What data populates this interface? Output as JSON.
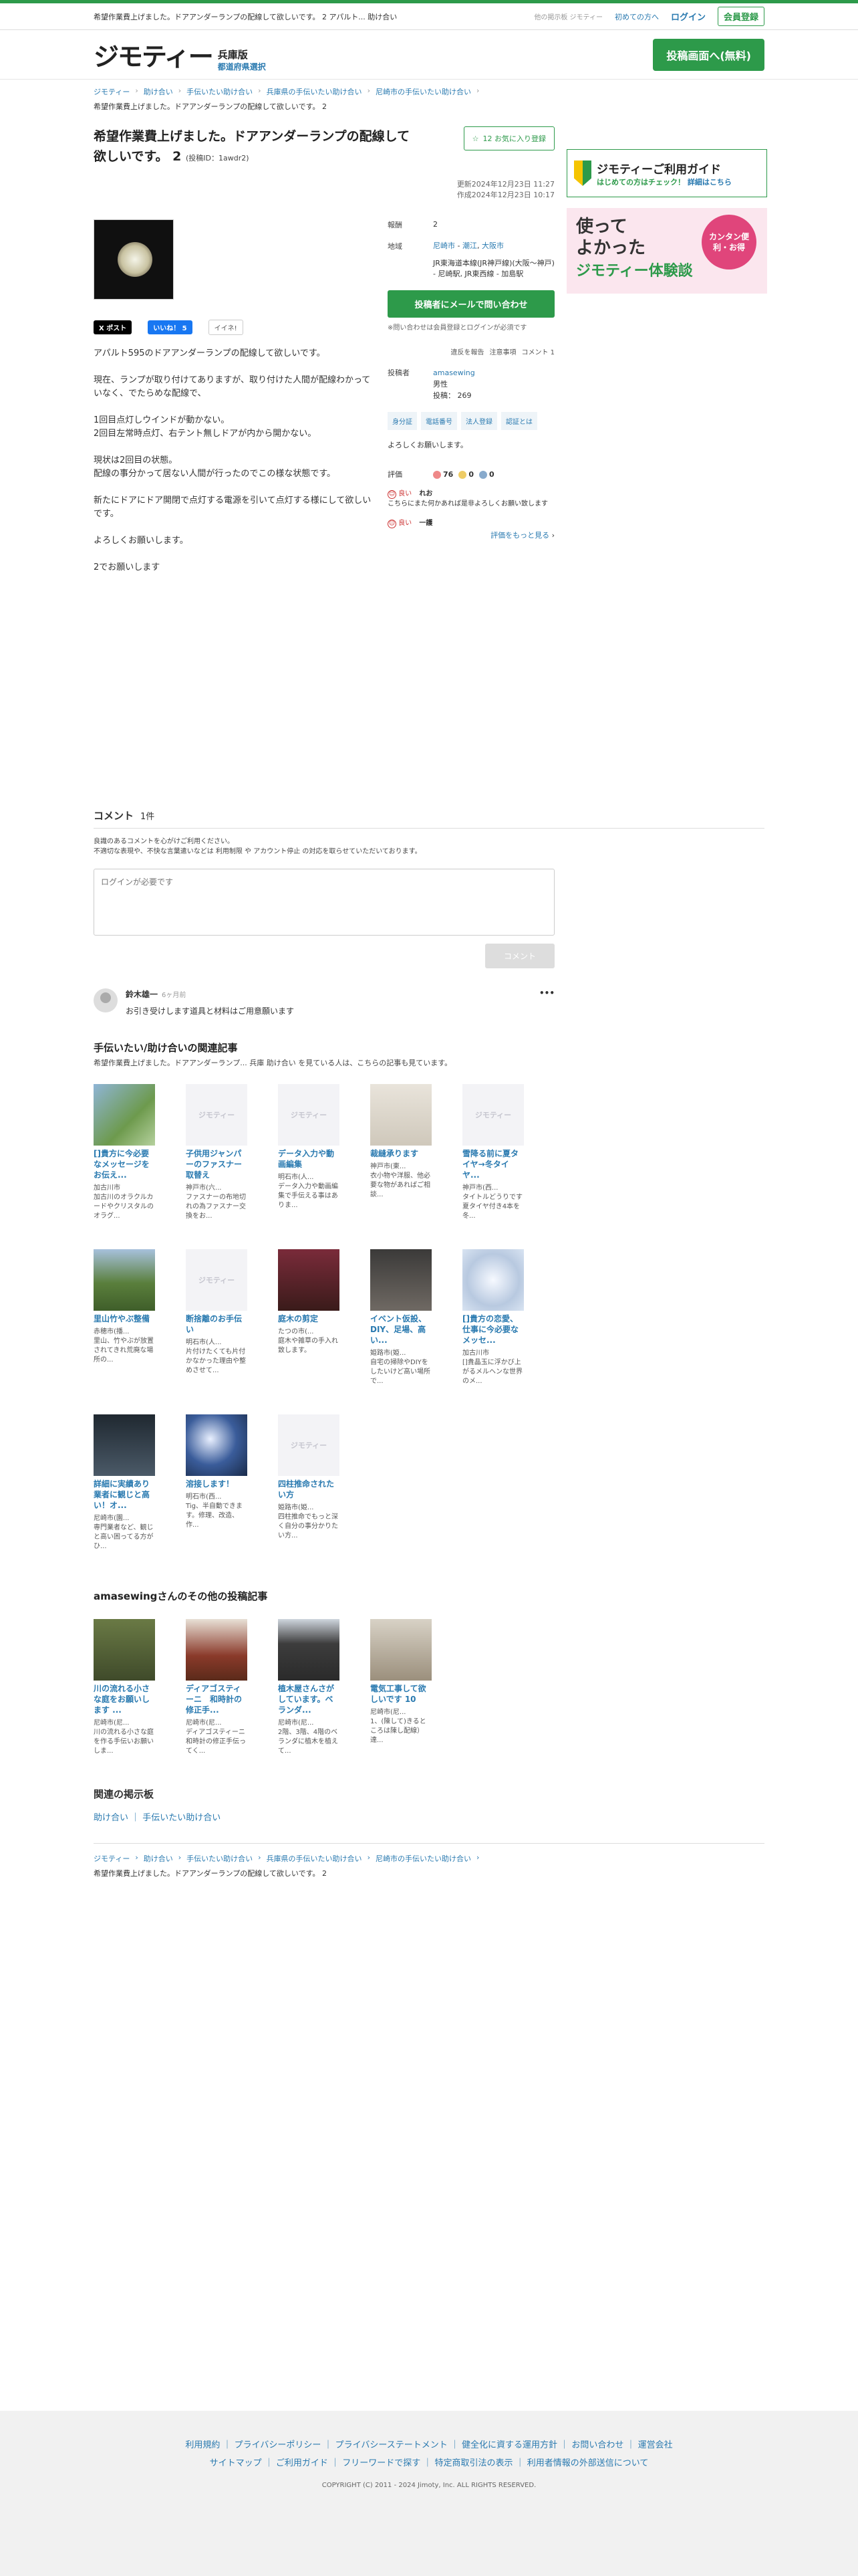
{
  "topbar": {
    "desc": "希望作業費上げました。ドアアンダーランプの配線して欲しいです。 2 アパルト... 助け合い",
    "other_boards": "他の掲示板 ジモティー",
    "first_time": "初めての方へ",
    "login": "ログイン",
    "register": "会員登録"
  },
  "header": {
    "brand": "ジモティー",
    "pref": "兵庫版",
    "pref_select": "都道府県選択",
    "post_button": "投稿画面へ(無料)"
  },
  "breadcrumbs": [
    "ジモティー",
    "助け合い",
    "手伝いたい助け合い",
    "兵庫県の手伝いたい助け合い",
    "尼崎市の手伝いたい助け合い"
  ],
  "breadcrumb_title": "希望作業費上げました。ドアアンダーランプの配線して欲しいです。 2",
  "post": {
    "title": "希望作業費上げました。ドアアンダーランプの配線して欲しいです。 2",
    "post_id": "(投稿ID：1awdr2)",
    "favorite": "12 お気に入り登録",
    "updated": "更新2024年12月23日 11:27",
    "created": "作成2024年12月23日 10:17",
    "social": {
      "x": "X ポスト",
      "fb": "いいね！ 5",
      "ii": "イイネ!"
    },
    "body": [
      "アパルト595のドアアンダーランプの配線して欲しいです。",
      "現在、ランプが取り付けてありますが、取り付けた人間が配線わかっていなく、でたらめな配線で、",
      "1回目点灯しウインドが動かない。\n2回目左常時点灯、右テント無しドアが内から開かない。",
      "現状は2回目の状態。\n配線の事分かって居ない人間が行ったのでこの様な状態です。",
      "新たにドアにドア開閉で点灯する電源を引いて点灯する様にして欲しいです。",
      "よろしくお願いします。",
      "2でお願いします"
    ]
  },
  "info": {
    "reward_label": "報酬",
    "reward_value": "2",
    "area_label": "地域",
    "area_links": [
      "尼崎市",
      "潮江",
      "大阪市"
    ],
    "stations": "JR東海道本線(JR神戸線)(大阪～神戸) - 尼崎駅, JR東西線 - 加島駅",
    "contact": "投稿者にメールで問い合わせ",
    "contact_note": "※問い合わせは会員登録とログインが必須です",
    "report": [
      "違反を報告",
      "注意事項",
      "コメント 1"
    ],
    "poster_label": "投稿者",
    "poster_name": "amasewing",
    "poster_gender": "男性",
    "poster_posts": "投稿： 269",
    "verifications": [
      "身分証",
      "電話番号",
      "法人登録",
      "認証とは"
    ],
    "greeting": "よろしくお願いします。",
    "rating_label": "評価",
    "rating_good": "76",
    "rating_normal": "0",
    "rating_bad": "0",
    "reviews": [
      {
        "tag": "良い",
        "user": "れお",
        "text": "こちらにまた何かあれば是非よろしくお願い致します"
      },
      {
        "tag": "良い",
        "user": "一護",
        "text": ""
      }
    ],
    "more": "評価をもっと見る"
  },
  "sidebar": {
    "guide_title": "ジモティーご利用ガイド",
    "guide_sub": "はじめての方はチェック！",
    "guide_link": "詳細はこちら",
    "banner_l1": "使って",
    "banner_l2": "よかった",
    "banner_l3": "ジモティー体験談",
    "banner_circle": "カンタン便利・お得"
  },
  "comments": {
    "title": "コメント",
    "count": "1件",
    "rule1": "良識のあるコメントを心がけご利用ください。",
    "rule2": "不適切な表現や、不快な言葉遣いなどは 利用制限 や アカウント停止 の対応を取らせていただいております。",
    "placeholder": "ログインが必要です",
    "submit": "コメント",
    "items": [
      {
        "name": "鈴木雄一",
        "time": "6ヶ月前",
        "text": "お引き受けします道具と材料はご用意願います"
      }
    ]
  },
  "related": {
    "title": "手伝いたい/助け合いの関連記事",
    "sub": "希望作業費上げました。ドアアンダーランプ... 兵庫 助け合い を見ている人は、こちらの記事も見ています。",
    "items": [
      {
        "title": "[]貴方に今必要なメッセージをお伝え...",
        "loc": "加古川市",
        "desc": "加古川のオラクルカードやクリスタルのオラグ...",
        "thumb": "photo-flowers"
      },
      {
        "title": "子供用ジャンパーのファスナー取替え",
        "loc": "神戸市(六...",
        "desc": "ファスナーの布地切れの為ファスナー交換をお...",
        "thumb": "placeholder"
      },
      {
        "title": "データ入力や動画編集",
        "loc": "明石市(人...",
        "desc": "データ入力や動画編集で手伝える事はありま...",
        "thumb": "placeholder"
      },
      {
        "title": "裁縫承ります",
        "loc": "神戸市(東...",
        "desc": "衣小物や洋服、他必要な物があればご相談...",
        "thumb": "photo-cloth"
      },
      {
        "title": "雪降る前に夏タイヤ→冬タイヤ...",
        "loc": "神戸市(西...",
        "desc": "タイトルどうりです 夏タイヤ付き4本を冬...",
        "thumb": "placeholder"
      },
      {
        "title": "里山竹やぶ整備",
        "loc": "赤穂市(播...",
        "desc": "里山、竹やぶが放置されてきれ荒廃な場所の...",
        "thumb": "photo-green"
      },
      {
        "title": "断捨離のお手伝い",
        "loc": "明石市(人...",
        "desc": "片付けたくても片付かなかった理由や整めさせて...",
        "thumb": "placeholder"
      },
      {
        "title": "庭木の剪定",
        "loc": "たつの市(...",
        "desc": "庭木や雑草の手入れ致します。",
        "thumb": "photo-door"
      },
      {
        "title": "イベント仮設、DIY、足場、高い...",
        "loc": "姫路市(姫...",
        "desc": "自宅の掃除やDIYをしたいけど高い場所で...",
        "thumb": "photo-dark"
      },
      {
        "title": "[]貴方の恋愛、仕事に今必要なメッセ...",
        "loc": "加古川市",
        "desc": "[]貴晶玉に浮かび上がるメルヘンな世界のメ...",
        "thumb": "photo-crystal"
      },
      {
        "title": "詳細に実績あり業者に観じと高い！オ...",
        "loc": "尼崎市(園...",
        "desc": "専門業者など、観じと高い困ってる方がひ...",
        "thumb": "photo-bike"
      },
      {
        "title": "溶接します！",
        "loc": "明石市(西...",
        "desc": "Tig、半自動できます。修理、改造、作...",
        "thumb": "photo-weld"
      },
      {
        "title": "四柱推命されたい方",
        "loc": "姫路市(姫...",
        "desc": "四柱推命でもっと深く自分の事分かりたい方...",
        "thumb": "placeholder"
      }
    ]
  },
  "other_posts": {
    "title": "amasewingさんのその他の投稿記事",
    "items": [
      {
        "title": "川の流れる小さな庭をお願いします ...",
        "loc": "尼崎市(尼...",
        "desc": "川の流れる小さな庭を作る手伝いお願いしま...",
        "thumb": "photo-garden"
      },
      {
        "title": "ディアゴスティーニ　和時計の修正手...",
        "loc": "尼崎市(尼...",
        "desc": "ディアゴスティーニ和時計の修正手伝ってく...",
        "thumb": "photo-clock"
      },
      {
        "title": "植木屋さんさがしています。ベランダ...",
        "loc": "尼崎市(尼...",
        "desc": "2階、3階、4階のベランダに植木を植えて...",
        "thumb": "photo-building"
      },
      {
        "title": "電気工事して欲しいです 10",
        "loc": "尼崎市(尼...",
        "desc": "1、(陳して)きるところは陳し配線）達...",
        "thumb": "photo-room"
      }
    ]
  },
  "related_boards": {
    "title": "関連の掲示板",
    "links": [
      "助け合い",
      "手伝いたい助け合い"
    ]
  },
  "footer": {
    "row1": [
      "利用規約",
      "プライバシーポリシー",
      "プライバシーステートメント",
      "健全化に資する運用方針",
      "お問い合わせ",
      "運営会社"
    ],
    "row2": [
      "サイトマップ",
      "ご利用ガイド",
      "フリーワードで探す",
      "特定商取引法の表示",
      "利用者情報の外部送信について"
    ],
    "copyright": "COPYRIGHT (C) 2011 - 2024 Jimoty, Inc. ALL RIGHTS RESERVED."
  },
  "colors": {
    "accent": "#2d9a4a",
    "link": "#2a7ab0"
  }
}
